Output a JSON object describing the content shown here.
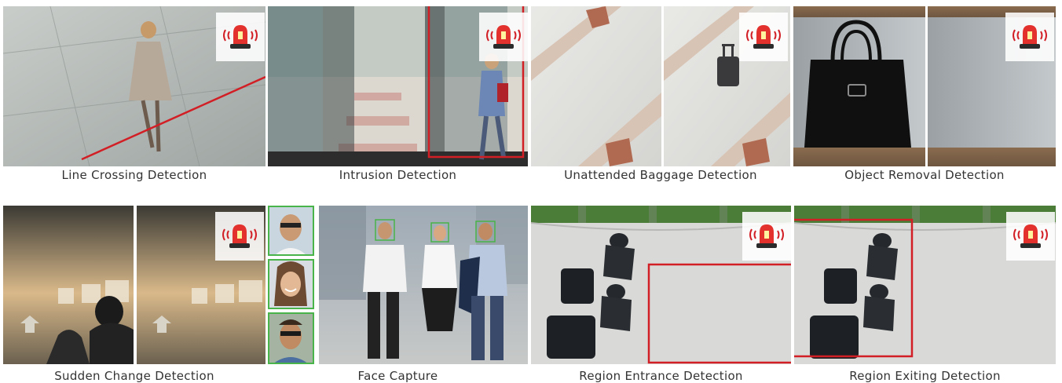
{
  "colors": {
    "detection_line": "#d21f26",
    "face_box": "#49b449",
    "alarm_red": "#e3312d"
  },
  "icons": {
    "alarm": "alarm-siren-icon"
  },
  "captions": {
    "line_crossing": "Line Crossing Detection",
    "intrusion": "Intrusion Detection",
    "unattended_baggage": "Unattended Baggage Detection",
    "object_removal": "Object Removal Detection",
    "sudden_change": "Sudden Change Detection",
    "face_capture": "Face Capture",
    "region_entrance": "Region Entrance Detection",
    "region_exiting": "Region Exiting Detection"
  }
}
